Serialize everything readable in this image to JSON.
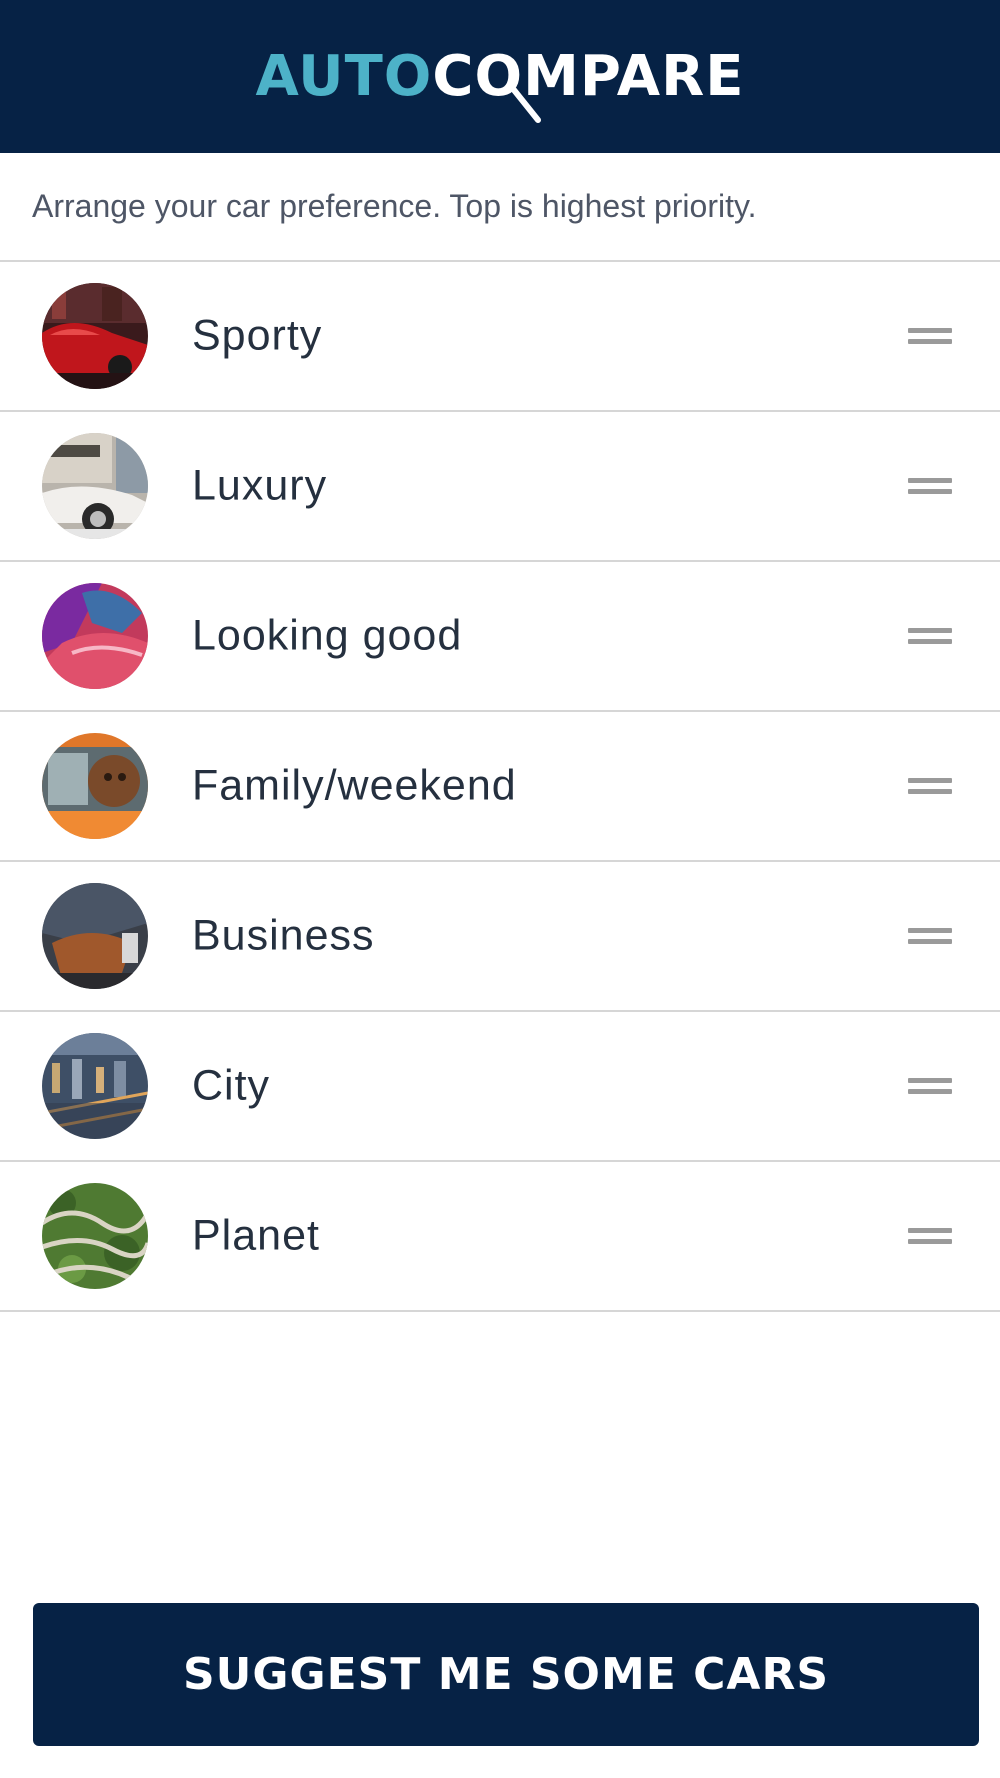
{
  "header": {
    "logo_part1": "AUTO",
    "logo_part2": "COMPARE",
    "colors": {
      "background": "#062245",
      "accent": "#4db2c8"
    }
  },
  "instruction": "Arrange your car preference. Top is highest priority.",
  "preferences": [
    {
      "label": "Sporty",
      "image_icon": "red-sports-car-photo"
    },
    {
      "label": "Luxury",
      "image_icon": "white-classic-car-photo"
    },
    {
      "label": "Looking good",
      "image_icon": "pink-car-closeup-photo"
    },
    {
      "label": "Family/weekend",
      "image_icon": "dog-in-car-photo"
    },
    {
      "label": "Business",
      "image_icon": "businessman-photo"
    },
    {
      "label": "City",
      "image_icon": "city-aerial-photo"
    },
    {
      "label": "Planet",
      "image_icon": "winding-green-road-photo"
    }
  ],
  "cta": {
    "label": "SUGGEST ME SOME CARS",
    "color": "#062245"
  }
}
